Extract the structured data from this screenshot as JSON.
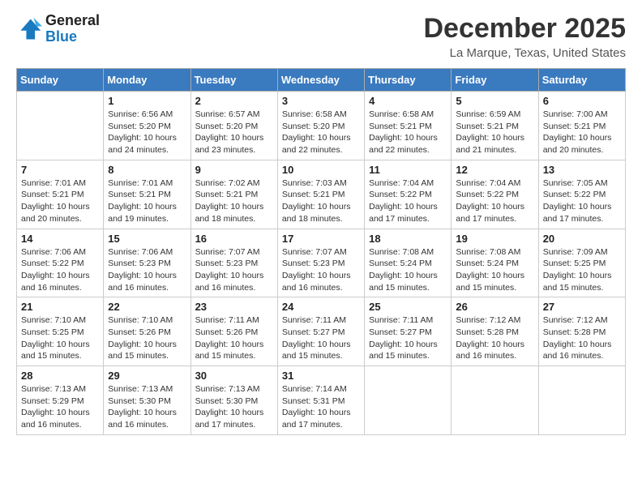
{
  "logo": {
    "line1": "General",
    "line2": "Blue"
  },
  "title": "December 2025",
  "subtitle": "La Marque, Texas, United States",
  "days_of_week": [
    "Sunday",
    "Monday",
    "Tuesday",
    "Wednesday",
    "Thursday",
    "Friday",
    "Saturday"
  ],
  "weeks": [
    [
      {
        "day": "",
        "info": ""
      },
      {
        "day": "1",
        "info": "Sunrise: 6:56 AM\nSunset: 5:20 PM\nDaylight: 10 hours\nand 24 minutes."
      },
      {
        "day": "2",
        "info": "Sunrise: 6:57 AM\nSunset: 5:20 PM\nDaylight: 10 hours\nand 23 minutes."
      },
      {
        "day": "3",
        "info": "Sunrise: 6:58 AM\nSunset: 5:20 PM\nDaylight: 10 hours\nand 22 minutes."
      },
      {
        "day": "4",
        "info": "Sunrise: 6:58 AM\nSunset: 5:21 PM\nDaylight: 10 hours\nand 22 minutes."
      },
      {
        "day": "5",
        "info": "Sunrise: 6:59 AM\nSunset: 5:21 PM\nDaylight: 10 hours\nand 21 minutes."
      },
      {
        "day": "6",
        "info": "Sunrise: 7:00 AM\nSunset: 5:21 PM\nDaylight: 10 hours\nand 20 minutes."
      }
    ],
    [
      {
        "day": "7",
        "info": "Sunrise: 7:01 AM\nSunset: 5:21 PM\nDaylight: 10 hours\nand 20 minutes."
      },
      {
        "day": "8",
        "info": "Sunrise: 7:01 AM\nSunset: 5:21 PM\nDaylight: 10 hours\nand 19 minutes."
      },
      {
        "day": "9",
        "info": "Sunrise: 7:02 AM\nSunset: 5:21 PM\nDaylight: 10 hours\nand 18 minutes."
      },
      {
        "day": "10",
        "info": "Sunrise: 7:03 AM\nSunset: 5:21 PM\nDaylight: 10 hours\nand 18 minutes."
      },
      {
        "day": "11",
        "info": "Sunrise: 7:04 AM\nSunset: 5:22 PM\nDaylight: 10 hours\nand 17 minutes."
      },
      {
        "day": "12",
        "info": "Sunrise: 7:04 AM\nSunset: 5:22 PM\nDaylight: 10 hours\nand 17 minutes."
      },
      {
        "day": "13",
        "info": "Sunrise: 7:05 AM\nSunset: 5:22 PM\nDaylight: 10 hours\nand 17 minutes."
      }
    ],
    [
      {
        "day": "14",
        "info": "Sunrise: 7:06 AM\nSunset: 5:22 PM\nDaylight: 10 hours\nand 16 minutes."
      },
      {
        "day": "15",
        "info": "Sunrise: 7:06 AM\nSunset: 5:23 PM\nDaylight: 10 hours\nand 16 minutes."
      },
      {
        "day": "16",
        "info": "Sunrise: 7:07 AM\nSunset: 5:23 PM\nDaylight: 10 hours\nand 16 minutes."
      },
      {
        "day": "17",
        "info": "Sunrise: 7:07 AM\nSunset: 5:23 PM\nDaylight: 10 hours\nand 16 minutes."
      },
      {
        "day": "18",
        "info": "Sunrise: 7:08 AM\nSunset: 5:24 PM\nDaylight: 10 hours\nand 15 minutes."
      },
      {
        "day": "19",
        "info": "Sunrise: 7:08 AM\nSunset: 5:24 PM\nDaylight: 10 hours\nand 15 minutes."
      },
      {
        "day": "20",
        "info": "Sunrise: 7:09 AM\nSunset: 5:25 PM\nDaylight: 10 hours\nand 15 minutes."
      }
    ],
    [
      {
        "day": "21",
        "info": "Sunrise: 7:10 AM\nSunset: 5:25 PM\nDaylight: 10 hours\nand 15 minutes."
      },
      {
        "day": "22",
        "info": "Sunrise: 7:10 AM\nSunset: 5:26 PM\nDaylight: 10 hours\nand 15 minutes."
      },
      {
        "day": "23",
        "info": "Sunrise: 7:11 AM\nSunset: 5:26 PM\nDaylight: 10 hours\nand 15 minutes."
      },
      {
        "day": "24",
        "info": "Sunrise: 7:11 AM\nSunset: 5:27 PM\nDaylight: 10 hours\nand 15 minutes."
      },
      {
        "day": "25",
        "info": "Sunrise: 7:11 AM\nSunset: 5:27 PM\nDaylight: 10 hours\nand 15 minutes."
      },
      {
        "day": "26",
        "info": "Sunrise: 7:12 AM\nSunset: 5:28 PM\nDaylight: 10 hours\nand 16 minutes."
      },
      {
        "day": "27",
        "info": "Sunrise: 7:12 AM\nSunset: 5:28 PM\nDaylight: 10 hours\nand 16 minutes."
      }
    ],
    [
      {
        "day": "28",
        "info": "Sunrise: 7:13 AM\nSunset: 5:29 PM\nDaylight: 10 hours\nand 16 minutes."
      },
      {
        "day": "29",
        "info": "Sunrise: 7:13 AM\nSunset: 5:30 PM\nDaylight: 10 hours\nand 16 minutes."
      },
      {
        "day": "30",
        "info": "Sunrise: 7:13 AM\nSunset: 5:30 PM\nDaylight: 10 hours\nand 17 minutes."
      },
      {
        "day": "31",
        "info": "Sunrise: 7:14 AM\nSunset: 5:31 PM\nDaylight: 10 hours\nand 17 minutes."
      },
      {
        "day": "",
        "info": ""
      },
      {
        "day": "",
        "info": ""
      },
      {
        "day": "",
        "info": ""
      }
    ]
  ]
}
